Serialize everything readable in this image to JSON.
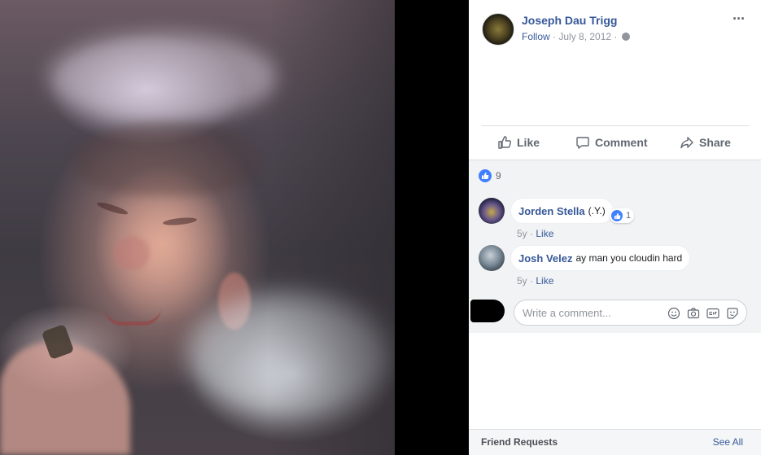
{
  "post": {
    "author": "Joseph Dau Trigg",
    "follow": "Follow",
    "separator": " · ",
    "date": "July 8, 2012",
    "more": "···"
  },
  "actions": {
    "like": "Like",
    "comment": "Comment",
    "share": "Share"
  },
  "reactions": {
    "count": "9"
  },
  "comments": [
    {
      "name": "Jorden Stella",
      "text": "(.Y.)",
      "reaction_count": "1",
      "age": "5y",
      "like": "Like"
    },
    {
      "name": "Josh Velez",
      "text": "ay man you cloudin hard",
      "age": "5y",
      "like": "Like"
    }
  ],
  "composer": {
    "placeholder": "Write a comment..."
  },
  "friend_requests": {
    "title": "Friend Requests",
    "see_all": "See All"
  },
  "colors": {
    "link": "#365899",
    "like_blue": "#4080ff",
    "muted": "#90949c"
  }
}
